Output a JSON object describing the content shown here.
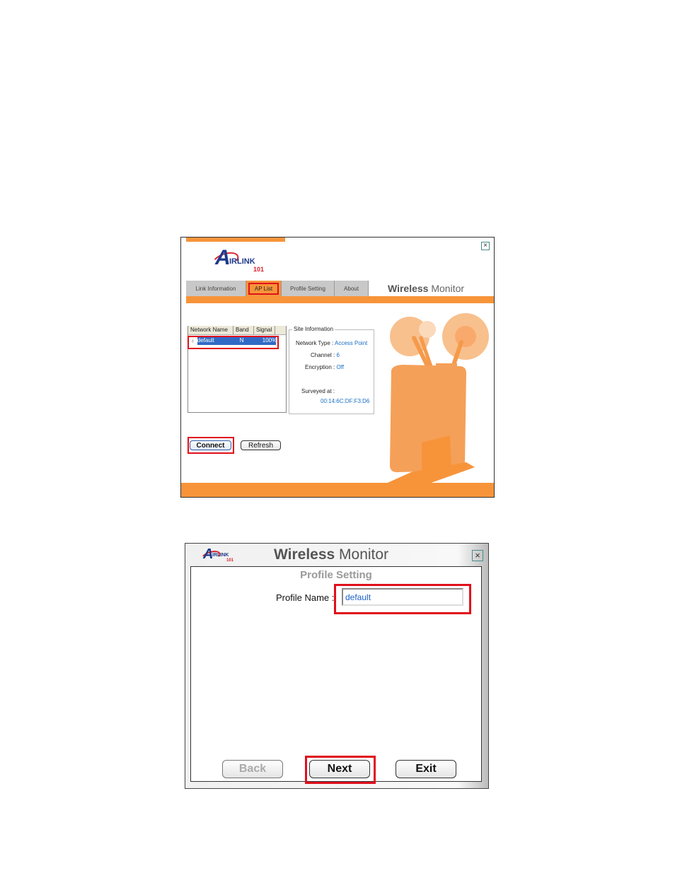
{
  "window1": {
    "logo": {
      "brand_letter": "A",
      "brand_rest": "IRLINK",
      "brand_number": "101"
    },
    "close_glyph": "×",
    "tabs": [
      {
        "label": "Link Information",
        "active": false
      },
      {
        "label": "AP List",
        "active": true
      },
      {
        "label": "Profile Setting",
        "active": false
      },
      {
        "label": "About",
        "active": false
      }
    ],
    "app_title_bold": "Wireless",
    "app_title_light": " Monitor",
    "ap_list": {
      "columns": [
        "Network Name",
        "Band",
        "Signal"
      ],
      "rows": [
        {
          "icon": "antenna-icon",
          "network_name": "default",
          "band": "N",
          "signal": "100%",
          "selected": true
        }
      ]
    },
    "site_information": {
      "legend": "Site Information",
      "network_type_label": "Network Type :",
      "network_type_value": "Access Point",
      "channel_label": "Channel :",
      "channel_value": "6",
      "encryption_label": "Encryption :",
      "encryption_value": "Off",
      "surveyed_label": "Surveyed at :",
      "surveyed_value": "00:14:6C:DF:F3:D6"
    },
    "buttons": {
      "connect": "Connect",
      "refresh": "Refresh"
    },
    "colors": {
      "accent": "#f7943a",
      "highlight": "#e0101c",
      "selection": "#316ac5"
    }
  },
  "window2": {
    "logo": {
      "brand_letter": "A",
      "brand_rest": "IRLINK",
      "brand_number": "101"
    },
    "app_title_bold": "Wireless",
    "app_title_light": " Monitor",
    "close_glyph": "×",
    "subtitle": "Profile Setting",
    "profile_name_label": "Profile Name :",
    "profile_name_value": "default",
    "buttons": {
      "back": "Back",
      "next": "Next",
      "exit": "Exit"
    },
    "back_disabled": true
  }
}
